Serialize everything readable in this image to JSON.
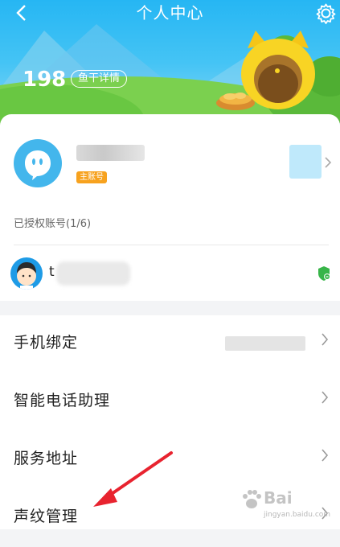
{
  "header": {
    "title": "个人中心",
    "coins": "198",
    "coin_detail_label": "鱼干详情"
  },
  "profile": {
    "badge": "主账号"
  },
  "authorized": {
    "label": "已授权账号(1/6)",
    "sub_account_initial": "t"
  },
  "menu": {
    "items": [
      {
        "label": "手机绑定"
      },
      {
        "label": "智能电话助理"
      },
      {
        "label": "服务地址"
      },
      {
        "label": "声纹管理"
      }
    ]
  },
  "watermark": {
    "text": "Bai",
    "sub": "jingyan.baidu.com"
  },
  "colors": {
    "sky": "#2fb8f3",
    "accent_blue": "#43b6ec",
    "badge_orange": "#f7a21e",
    "annotation_red": "#e8232f",
    "shield_green": "#38b549"
  }
}
